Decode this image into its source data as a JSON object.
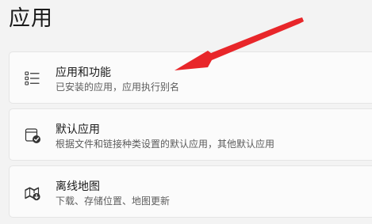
{
  "page": {
    "title": "应用"
  },
  "items": [
    {
      "icon": "apps-features-list-icon",
      "title": "应用和功能",
      "description": "已安装的应用，应用执行别名"
    },
    {
      "icon": "default-apps-icon",
      "title": "默认应用",
      "description": "根据文件和链接种类设置的默认应用，其他默认应用"
    },
    {
      "icon": "offline-maps-icon",
      "title": "离线地图",
      "description": "下载、存储位置、地图更新"
    }
  ],
  "annotation": {
    "arrow_color": "#e8262a"
  }
}
